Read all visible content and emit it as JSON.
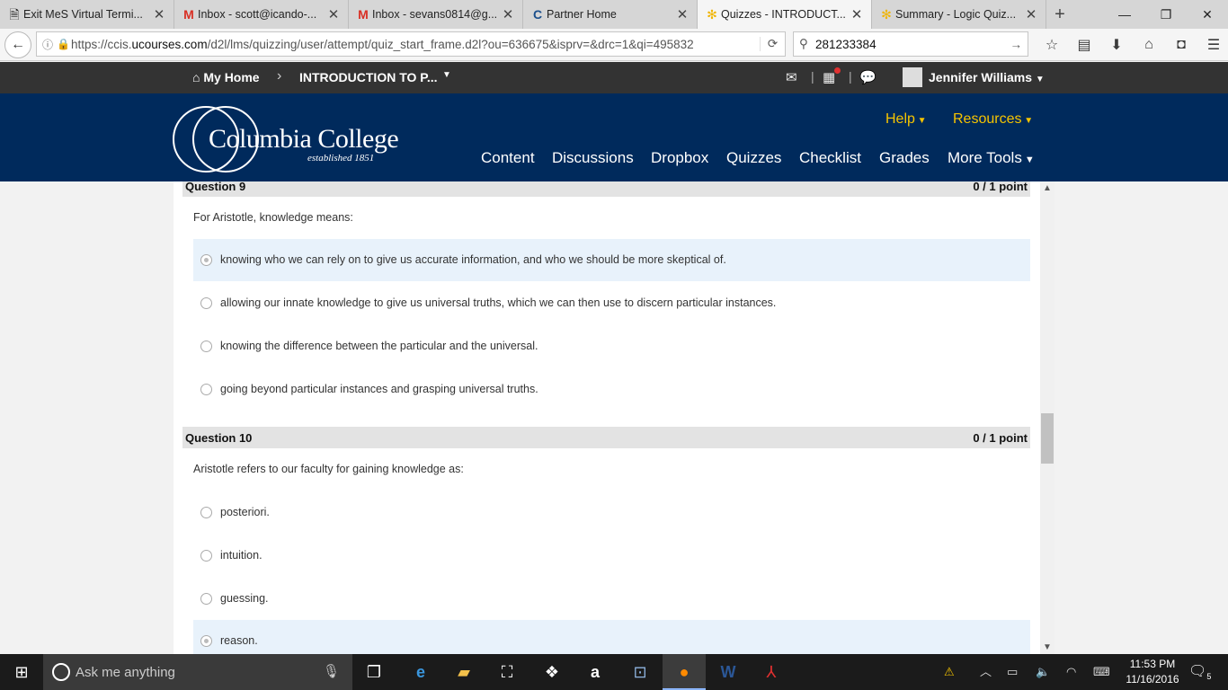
{
  "browser": {
    "tabs": [
      {
        "label": "Exit MeS Virtual Termi...",
        "icon": "document-icon"
      },
      {
        "label": "Inbox - scott@icando-...",
        "icon": "gmail-icon"
      },
      {
        "label": "Inbox - sevans0814@g...",
        "icon": "gmail-icon"
      },
      {
        "label": "Partner Home",
        "icon": "partner-icon"
      },
      {
        "label": "Quizzes - INTRODUCT...",
        "icon": "d2l-icon"
      },
      {
        "label": "Summary - Logic Quiz...",
        "icon": "d2l-icon"
      }
    ],
    "url_prefix": "https://ccis.",
    "url_domain": "ucourses.com",
    "url_rest": "/d2l/lms/quizzing/user/attempt/quiz_start_frame.d2l?ou=636675&isprv=&drc=1&qi=495832",
    "search_value": "281233384"
  },
  "d2l": {
    "home_label": "My Home",
    "course_label": "INTRODUCTION TO P...",
    "user_name": "Jennifer Williams"
  },
  "banner": {
    "college_name": "Columbia College",
    "established": "established 1851",
    "help_label": "Help",
    "resources_label": "Resources",
    "nav": [
      "Content",
      "Discussions",
      "Dropbox",
      "Quizzes",
      "Checklist",
      "Grades",
      "More Tools"
    ]
  },
  "questions": [
    {
      "title": "Question 9",
      "points": "0 / 1 point",
      "text": "For Aristotle, knowledge means:",
      "options": [
        {
          "label": "knowing who we can rely on to give us accurate information, and who we should be more skeptical of.",
          "selected": true
        },
        {
          "label": "allowing our innate knowledge to give us universal truths, which we can then use to discern particular instances.",
          "selected": false
        },
        {
          "label": "knowing the difference between the particular and the universal.",
          "selected": false
        },
        {
          "label": "going beyond particular instances and grasping universal truths.",
          "selected": false
        }
      ]
    },
    {
      "title": "Question 10",
      "points": "0 / 1 point",
      "text": "Aristotle refers to our faculty for gaining knowledge as:",
      "options": [
        {
          "label": "posteriori.",
          "selected": false
        },
        {
          "label": "intuition.",
          "selected": false
        },
        {
          "label": "guessing.",
          "selected": false
        },
        {
          "label": "reason.",
          "selected": true
        }
      ]
    }
  ],
  "taskbar": {
    "search_placeholder": "Ask me anything",
    "time": "11:53 PM",
    "date": "11/16/2016",
    "notification_count": "5"
  }
}
